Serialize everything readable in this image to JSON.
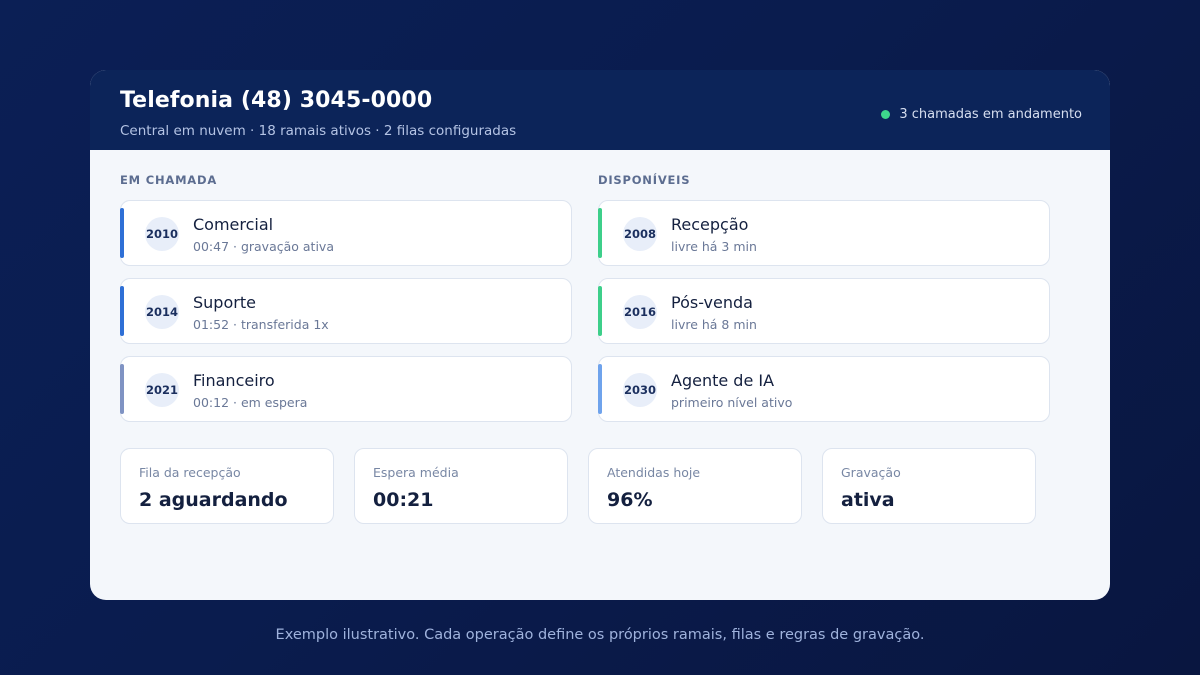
{
  "header": {
    "title": "Telefonia (48) 3045-0000",
    "subtitle": "Central em nuvem · 18 ramais ativos · 2 filas configuradas",
    "status_text": "3 chamadas em andamento",
    "status_color": "#3dd68c"
  },
  "in_call": {
    "label": "EM CHAMADA",
    "items": [
      {
        "number": "2010",
        "name": "Comercial",
        "meta": "00:47 · gravação ativa",
        "accent": "#2e6fd6"
      },
      {
        "number": "2014",
        "name": "Suporte",
        "meta": "01:52 · transferida 1x",
        "accent": "#2e6fd6"
      },
      {
        "number": "2021",
        "name": "Financeiro",
        "meta": "00:12 · em espera",
        "accent": "#7f93c3"
      }
    ]
  },
  "available": {
    "label": "DISPONÍVEIS",
    "items": [
      {
        "number": "2008",
        "name": "Recepção",
        "meta": "livre há 3 min",
        "accent": "#3dcf8a"
      },
      {
        "number": "2016",
        "name": "Pós-venda",
        "meta": "livre há 8 min",
        "accent": "#3dcf8a"
      },
      {
        "number": "2030",
        "name": "Agente de IA",
        "meta": "primeiro nível ativo",
        "accent": "#6fa3ec"
      }
    ]
  },
  "metrics": [
    {
      "label": "Fila da recepção",
      "value": "2 aguardando"
    },
    {
      "label": "Espera média",
      "value": "00:21"
    },
    {
      "label": "Atendidas hoje",
      "value": "96%"
    },
    {
      "label": "Gravação",
      "value": "ativa"
    }
  ],
  "footer": "Exemplo ilustrativo. Cada operação define os próprios ramais, filas e regras de gravação."
}
